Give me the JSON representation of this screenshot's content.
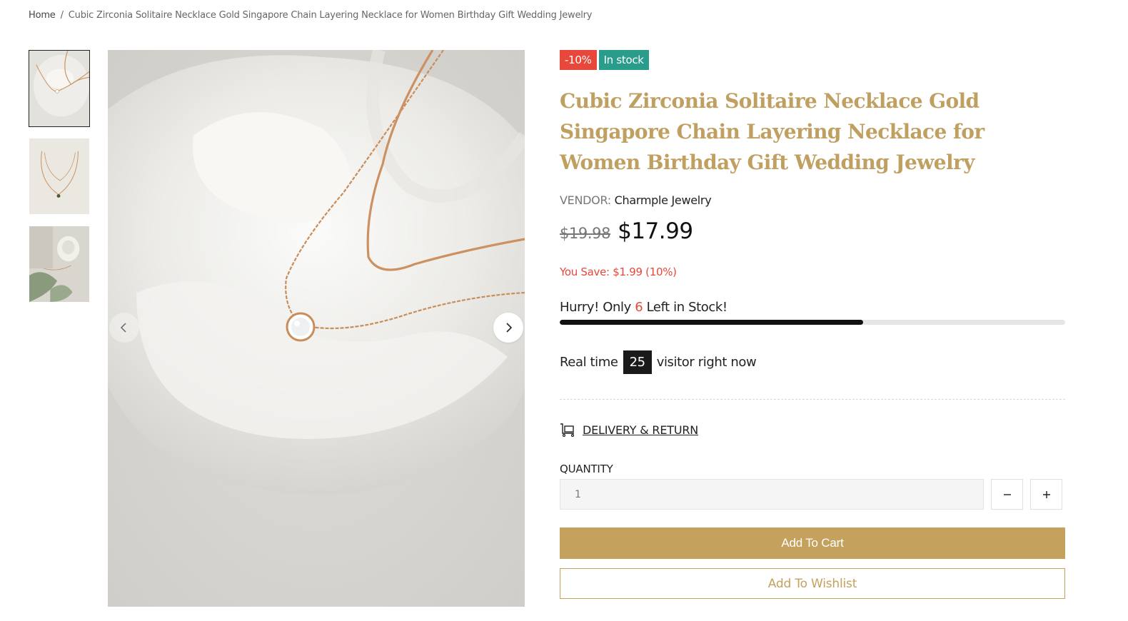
{
  "breadcrumb": {
    "home": "Home",
    "separator": "/",
    "current": "Cubic Zirconia Solitaire Necklace Gold Singapore Chain Layering Necklace for Women Birthday Gift Wedding Jewelry"
  },
  "gallery": {
    "thumbnail_count": 3,
    "active_index": 0,
    "prev_icon": "chevron-left-icon",
    "next_icon": "chevron-right-icon"
  },
  "product": {
    "badges": {
      "sale": "-10%",
      "stock": "In stock"
    },
    "title": "Cubic Zirconia Solitaire Necklace Gold Singapore Chain Layering Necklace for Women Birthday Gift Wedding Jewelry",
    "vendor_label": "VENDOR:",
    "vendor_name": "Charmple Jewelry",
    "old_price": "$19.98",
    "price": "$17.99",
    "you_save": "You Save: $1.99 (10%)"
  },
  "stock": {
    "prefix": "Hurry! Only",
    "count": "6",
    "suffix": "Left in Stock!",
    "level_fraction": 0.6
  },
  "visitors": {
    "prefix": "Real time",
    "count": "25",
    "suffix": "visitor right now"
  },
  "delivery": {
    "label": "DELIVERY & RETURN",
    "icon": "delivery-cart-icon"
  },
  "quantity": {
    "label": "QUANTITY",
    "value": "1",
    "minus": "−",
    "plus": "+"
  },
  "actions": {
    "add_to_cart": "Add To Cart",
    "add_to_wishlist": "Add To Wishlist"
  },
  "colors": {
    "accent_gold": "#c4a25d",
    "title_gold": "#c0a060",
    "sale_red": "#e8473b",
    "stock_teal": "#2a9c8c"
  }
}
